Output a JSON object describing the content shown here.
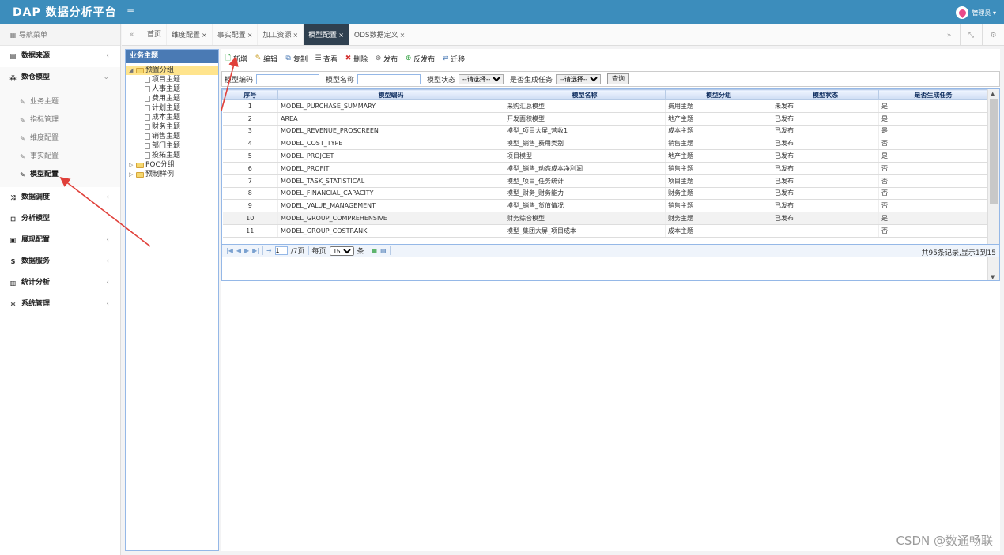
{
  "app": {
    "title": "DAP 数据分析平台",
    "menu_toggle": "≡",
    "user": "管理员 ▾"
  },
  "sidebar": {
    "nav_head": "导航菜单",
    "items": [
      {
        "label": "数据来源",
        "chev": "‹"
      },
      {
        "label": "数仓模型",
        "chev": "⌄"
      },
      {
        "label": "数据调度",
        "chev": "‹"
      },
      {
        "label": "分析模型",
        "chev": ""
      },
      {
        "label": "展现配置",
        "chev": "‹"
      },
      {
        "label": "数据服务",
        "chev": "‹"
      },
      {
        "label": "统计分析",
        "chev": "‹"
      },
      {
        "label": "系统管理",
        "chev": "‹"
      }
    ],
    "subitems": [
      "业务主题",
      "指标管理",
      "维度配置",
      "事实配置",
      "模型配置"
    ]
  },
  "tabs": {
    "items": [
      "首页",
      "维度配置",
      "事实配置",
      "加工资源",
      "模型配置",
      "ODS数据定义"
    ],
    "close": "×"
  },
  "tree": {
    "title": "业务主题",
    "root": "预置分组",
    "children": [
      "项目主题",
      "人事主题",
      "费用主题",
      "计划主题",
      "成本主题",
      "财务主题",
      "销售主题",
      "部门主题",
      "投拓主题"
    ],
    "others": [
      "POC分组",
      "预制样例"
    ]
  },
  "toolbar": {
    "add": "新增",
    "edit": "编辑",
    "copy": "复制",
    "view": "查看",
    "delete": "删除",
    "publish": "发布",
    "unpublish": "反发布",
    "migrate": "迁移"
  },
  "filters": {
    "code_label": "模型编码",
    "name_label": "模型名称",
    "status_label": "模型状态",
    "task_label": "是否生成任务",
    "select_placeholder": "--请选择--",
    "query": "查询"
  },
  "grid": {
    "columns": [
      "序号",
      "模型编码",
      "模型名称",
      "模型分组",
      "模型状态",
      "是否生成任务"
    ],
    "rows": [
      [
        "1",
        "MODEL_PURCHASE_SUMMARY",
        "采购汇总模型",
        "费用主题",
        "未发布",
        "是"
      ],
      [
        "2",
        "AREA",
        "开发面积模型",
        "地产主题",
        "已发布",
        "是"
      ],
      [
        "3",
        "MODEL_REVENUE_PROSCREEN",
        "模型_项目大屏_营收1",
        "成本主题",
        "已发布",
        "是"
      ],
      [
        "4",
        "MODEL_COST_TYPE",
        "模型_销售_费用类别",
        "销售主题",
        "已发布",
        "否"
      ],
      [
        "5",
        "MODEL_PROJCET",
        "项目模型",
        "地产主题",
        "已发布",
        "是"
      ],
      [
        "6",
        "MODEL_PROFIT",
        "模型_销售_动态成本净利润",
        "销售主题",
        "已发布",
        "否"
      ],
      [
        "7",
        "MODEL_TASK_STATISTICAL",
        "模型_项目_任务统计",
        "项目主题",
        "已发布",
        "否"
      ],
      [
        "8",
        "MODEL_FINANCIAL_CAPACITY",
        "模型_财务_财务能力",
        "财务主题",
        "已发布",
        "否"
      ],
      [
        "9",
        "MODEL_VALUE_MANAGEMENT",
        "模型_销售_货值情况",
        "销售主题",
        "已发布",
        "否"
      ],
      [
        "10",
        "MODEL_GROUP_COMPREHENSIVE",
        "财务综合模型",
        "财务主题",
        "已发布",
        "是"
      ],
      [
        "11",
        "MODEL_GROUP_COSTRANK",
        "模型_集团大屏_项目成本",
        "成本主题",
        "",
        "否"
      ]
    ]
  },
  "pager": {
    "page": "1",
    "pages": "/7页",
    "per_page_label": "每页",
    "per_page": "15",
    "unit": "条",
    "info": "共95条记录,显示1到15"
  },
  "watermark": "CSDN @数通畅联",
  "colors": {
    "header": "#3c8dbc",
    "active_tab": "#2f4050",
    "annotation": "#e0403a"
  }
}
